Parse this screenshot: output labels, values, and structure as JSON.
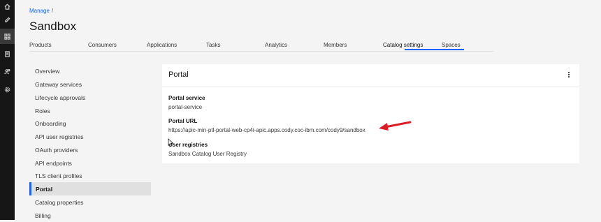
{
  "rail": {
    "icons": [
      "home-icon",
      "edit-icon",
      "dashboard-icon",
      "document-icon",
      "users-icon",
      "settings-icon"
    ]
  },
  "header": {
    "breadcrumb": "Manage",
    "breadcrumb_sep": "/",
    "title": "Sandbox"
  },
  "tabs": [
    {
      "label": "Products"
    },
    {
      "label": "Consumers"
    },
    {
      "label": "Applications"
    },
    {
      "label": "Tasks"
    },
    {
      "label": "Analytics"
    },
    {
      "label": "Members"
    },
    {
      "label": "Catalog settings",
      "selected": true
    },
    {
      "label": "Spaces"
    }
  ],
  "nav": {
    "items": [
      {
        "label": "Overview"
      },
      {
        "label": "Gateway services"
      },
      {
        "label": "Lifecycle approvals"
      },
      {
        "label": "Roles"
      },
      {
        "label": "Onboarding"
      },
      {
        "label": "API user registries"
      },
      {
        "label": "OAuth providers"
      },
      {
        "label": "API endpoints"
      },
      {
        "label": "TLS client profiles"
      },
      {
        "label": "Portal",
        "active": true
      },
      {
        "label": "Catalog properties"
      },
      {
        "label": "Billing"
      }
    ]
  },
  "card": {
    "title": "Portal",
    "portal_service_label": "Portal service",
    "portal_service_value": "portal-service",
    "portal_url_label": "Portal URL",
    "portal_url_value": "https://apic-min-ptl-portal-web-cp4i-apic.apps.cody.coc-ibm.com/cody9/sandbox",
    "user_registries_label": "User registries",
    "user_registries_value": "Sandbox Catalog User Registry"
  },
  "colors": {
    "rail": "#161616",
    "accent": "#0f62fe",
    "annotation_arrow": "#da1e28"
  }
}
